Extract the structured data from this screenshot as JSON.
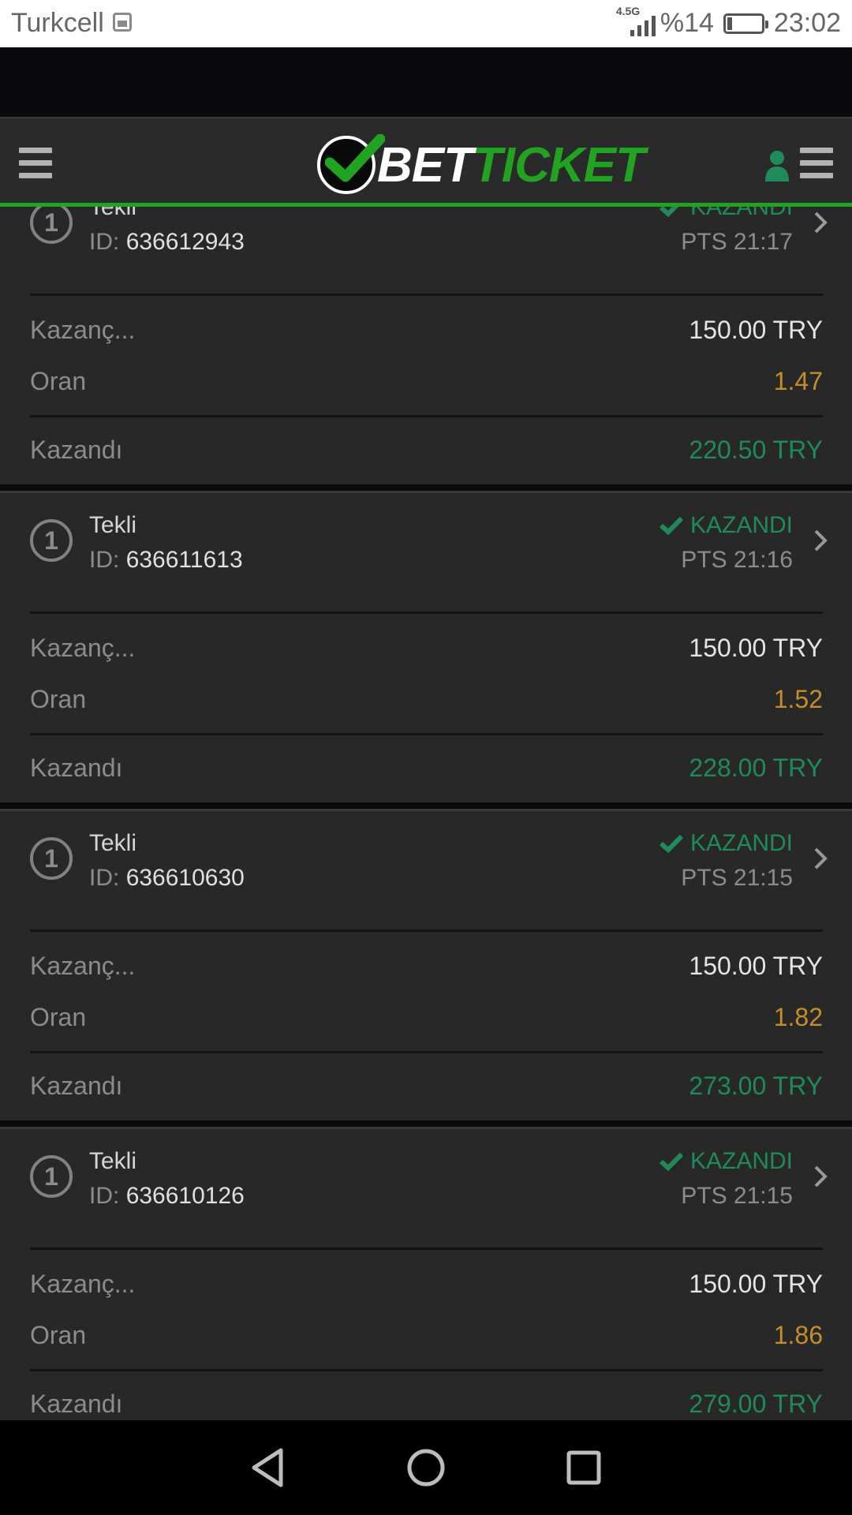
{
  "status_bar": {
    "carrier": "Turkcell",
    "network": "4.5G",
    "battery": "%14",
    "battery_level": 0.14,
    "time": "23:02"
  },
  "header": {
    "logo_bet": "BET",
    "logo_ticket": "TICKET",
    "icons": [
      "menu-icon",
      "user-icon",
      "menu-icon"
    ]
  },
  "colors": {
    "accent_green": "#21a321",
    "won_green": "#1f8b5a",
    "odds_gold": "#c58e2a",
    "background": "#282828"
  },
  "bets": [
    {
      "number": "1",
      "type": "Tekli",
      "id_label": "ID:",
      "id": "636612943",
      "status": "KAZANDI",
      "time": "PTS 21:17",
      "stake_label": "Kazanç...",
      "stake": "150.00 TRY",
      "odds_label": "Oran",
      "odds": "1.47",
      "won_label": "Kazandı",
      "won": "220.50 TRY"
    },
    {
      "number": "1",
      "type": "Tekli",
      "id_label": "ID:",
      "id": "636611613",
      "status": "KAZANDI",
      "time": "PTS 21:16",
      "stake_label": "Kazanç...",
      "stake": "150.00 TRY",
      "odds_label": "Oran",
      "odds": "1.52",
      "won_label": "Kazandı",
      "won": "228.00 TRY"
    },
    {
      "number": "1",
      "type": "Tekli",
      "id_label": "ID:",
      "id": "636610630",
      "status": "KAZANDI",
      "time": "PTS 21:15",
      "stake_label": "Kazanç...",
      "stake": "150.00 TRY",
      "odds_label": "Oran",
      "odds": "1.82",
      "won_label": "Kazandı",
      "won": "273.00 TRY"
    },
    {
      "number": "1",
      "type": "Tekli",
      "id_label": "ID:",
      "id": "636610126",
      "status": "KAZANDI",
      "time": "PTS 21:15",
      "stake_label": "Kazanç...",
      "stake": "150.00 TRY",
      "odds_label": "Oran",
      "odds": "1.86",
      "won_label": "Kazandı",
      "won": "279.00 TRY"
    }
  ],
  "nav": {
    "buttons": [
      "back-icon",
      "home-icon",
      "recents-icon"
    ]
  }
}
